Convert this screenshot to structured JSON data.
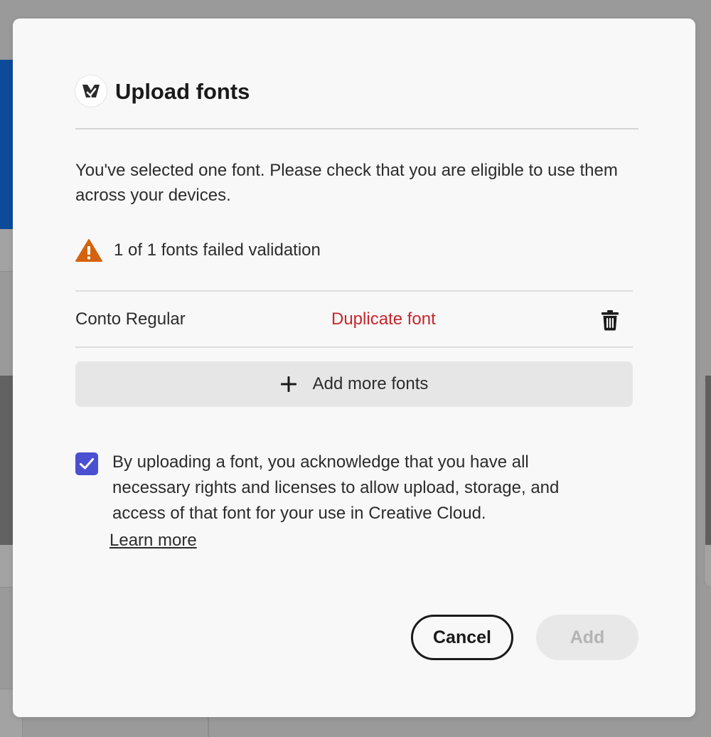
{
  "dialog": {
    "title": "Upload fonts",
    "description": "You've selected one font. Please check that you are eligible to use them across your devices.",
    "validation": {
      "icon": "warning-icon",
      "text": "1 of 1 fonts failed validation"
    },
    "fonts": [
      {
        "name": "Conto Regular",
        "status": "Duplicate font",
        "status_color": "#c9252c",
        "action_icon": "trash-icon"
      }
    ],
    "add_more_label": "Add more fonts",
    "acknowledgement": {
      "checked": true,
      "text": "By uploading a font, you acknowledge that you have all necessary rights and licenses to allow upload, storage, and access of that font for your use in Creative Cloud.",
      "link_label": "Learn more"
    },
    "buttons": {
      "cancel_label": "Cancel",
      "add_label": "Add",
      "add_enabled": false
    }
  },
  "colors": {
    "accent": "#4b4fd1",
    "warning": "#d4620f",
    "error": "#c9252c",
    "overlay": "#9a9a9a"
  }
}
